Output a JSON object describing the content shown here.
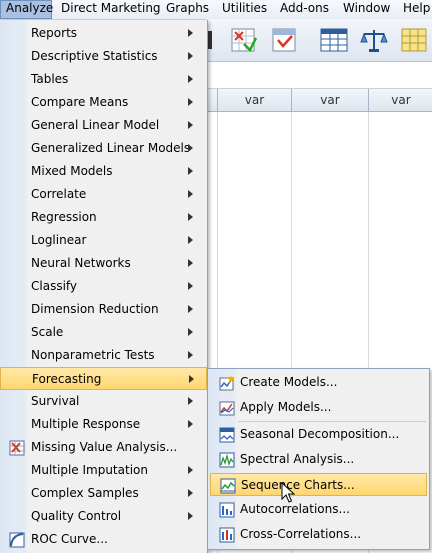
{
  "menubar": {
    "items": [
      {
        "label": "Analyze"
      },
      {
        "label": "Direct Marketing"
      },
      {
        "label": "Graphs"
      },
      {
        "label": "Utilities"
      },
      {
        "label": "Add-ons"
      },
      {
        "label": "Window"
      },
      {
        "label": "Help"
      }
    ]
  },
  "grid": {
    "columns": [
      "var",
      "var",
      "var"
    ]
  },
  "analyze_menu": {
    "items": [
      {
        "label": "Reports"
      },
      {
        "label": "Descriptive Statistics"
      },
      {
        "label": "Tables"
      },
      {
        "label": "Compare Means"
      },
      {
        "label": "General Linear Model"
      },
      {
        "label": "Generalized Linear Models"
      },
      {
        "label": "Mixed Models"
      },
      {
        "label": "Correlate"
      },
      {
        "label": "Regression"
      },
      {
        "label": "Loglinear"
      },
      {
        "label": "Neural Networks"
      },
      {
        "label": "Classify"
      },
      {
        "label": "Dimension Reduction"
      },
      {
        "label": "Scale"
      },
      {
        "label": "Nonparametric Tests"
      },
      {
        "label": "Forecasting"
      },
      {
        "label": "Survival"
      },
      {
        "label": "Multiple Response"
      },
      {
        "label": "Missing Value Analysis..."
      },
      {
        "label": "Multiple Imputation"
      },
      {
        "label": "Complex Samples"
      },
      {
        "label": "Quality Control"
      },
      {
        "label": "ROC Curve..."
      }
    ]
  },
  "forecasting_menu": {
    "items": [
      {
        "label": "Create Models..."
      },
      {
        "label": "Apply Models..."
      },
      {
        "label": "Seasonal Decomposition..."
      },
      {
        "label": "Spectral Analysis..."
      },
      {
        "label": "Sequence Charts..."
      },
      {
        "label": "Autocorrelations..."
      },
      {
        "label": "Cross-Correlations..."
      }
    ]
  },
  "colors": {
    "highlight": "#ffd66f",
    "menu_bg": "#f0f0f0",
    "gutter": "#dde7f4"
  }
}
